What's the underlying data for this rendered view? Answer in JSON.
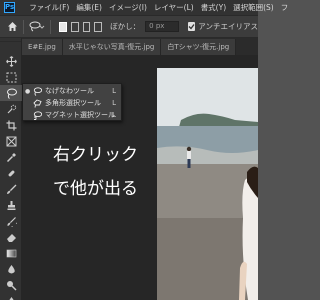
{
  "menubar": {
    "logo": "Ps",
    "items": [
      "ファイル(F)",
      "編集(E)",
      "イメージ(I)",
      "レイヤー(L)",
      "書式(Y)",
      "選択範囲(S)",
      "フ"
    ]
  },
  "options": {
    "feather_label": "ぼかし：",
    "feather_value": "0 px",
    "antialias_label": "アンチエイリアス"
  },
  "tabs": [
    "E#E.jpg",
    "水平じゃない写真-復元.jpg",
    "白Tシャツ-復元.jpg"
  ],
  "flyout": {
    "items": [
      {
        "label": "なげなわツール",
        "shortcut": "L",
        "icon": "lasso-icon"
      },
      {
        "label": "多角形選択ツール",
        "shortcut": "L",
        "icon": "polygonal-lasso-icon"
      },
      {
        "label": "マグネット選択ツール",
        "shortcut": "L",
        "icon": "magnetic-lasso-icon"
      }
    ]
  },
  "annotation": {
    "line1": "右クリック",
    "line2": "で他が出る"
  },
  "tools": [
    "move-icon",
    "marquee-icon",
    "lasso-icon",
    "quick-select-icon",
    "crop-icon",
    "frame-icon",
    "eyedropper-icon",
    "healing-brush-icon",
    "brush-icon",
    "clone-stamp-icon",
    "history-brush-icon",
    "eraser-icon",
    "gradient-icon",
    "blur-icon",
    "dodge-icon",
    "pen-icon"
  ]
}
